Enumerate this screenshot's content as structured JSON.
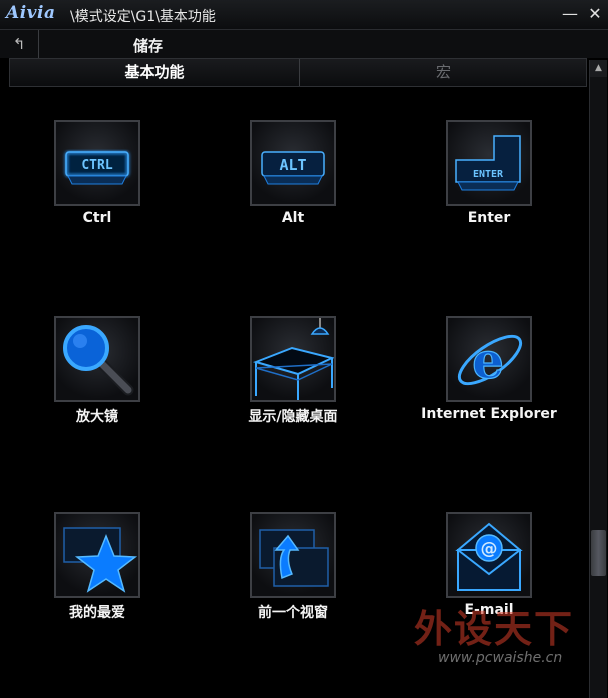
{
  "window": {
    "logo": "Aivia",
    "breadcrumb": "\\模式设定\\G1\\基本功能",
    "minimize_glyph": "—",
    "close_glyph": "✕"
  },
  "toolbar": {
    "back_glyph": "↰",
    "title": "储存"
  },
  "tabs": [
    {
      "label": "基本功能",
      "active": true
    },
    {
      "label": "宏",
      "active": false
    }
  ],
  "scrollbar": {
    "up_glyph": "▲"
  },
  "functions": [
    {
      "label": "Ctrl",
      "icon": "ctrl-key-icon"
    },
    {
      "label": "Alt",
      "icon": "alt-key-icon"
    },
    {
      "label": "Enter",
      "icon": "enter-key-icon"
    },
    {
      "label": "放大镜",
      "icon": "magnifier-icon"
    },
    {
      "label": "显示/隐藏桌面",
      "icon": "desktop-table-icon"
    },
    {
      "label": "Internet Explorer",
      "icon": "internet-explorer-icon"
    },
    {
      "label": "我的最爱",
      "icon": "favorites-star-icon"
    },
    {
      "label": "前一个视窗",
      "icon": "previous-window-icon"
    },
    {
      "label": "E-mail",
      "icon": "email-icon"
    }
  ],
  "icon_text": {
    "ctrl": "CTRL",
    "alt": "ALT",
    "enter": "ENTER"
  },
  "watermark": {
    "main": "外设天下",
    "url": "www.pcwaishe.cn"
  },
  "colors": {
    "accent": "#1e8fff",
    "glow": "#3aa8ff"
  }
}
